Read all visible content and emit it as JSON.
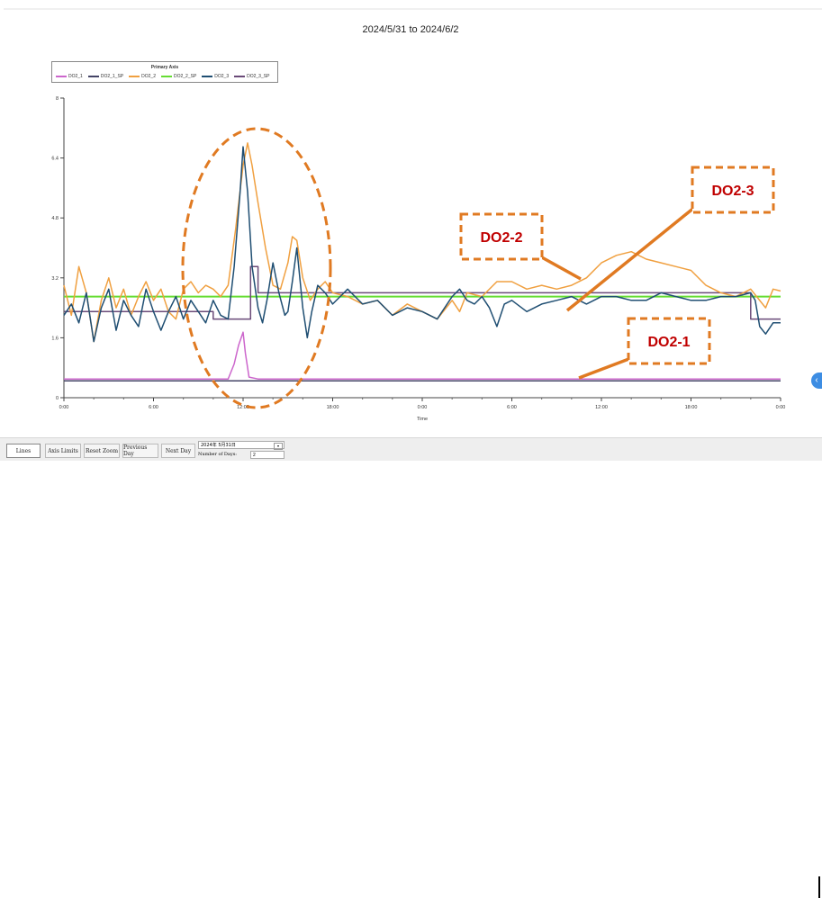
{
  "chart_data": {
    "type": "line",
    "title": "2024/5/31 to 2024/6/2",
    "xlabel": "Time",
    "ylabel": "",
    "xlim": [
      0,
      48
    ],
    "ylim": [
      0,
      8
    ],
    "grid": false,
    "y_ticks": [
      "0",
      "1.6",
      "3.2",
      "4.8",
      "6.4",
      "8"
    ],
    "y_tick_values": [
      0,
      1.6,
      3.2,
      4.8,
      6.4,
      8
    ],
    "x_ticks": [
      "0:00",
      "6:00",
      "12:00",
      "18:00",
      "0:00",
      "6:00",
      "12:00",
      "18:00",
      "0:00"
    ],
    "x_tick_values": [
      0,
      6,
      12,
      18,
      24,
      30,
      36,
      42,
      48
    ],
    "legend": {
      "title": "Primary Axis",
      "placement": "top-left",
      "entries": [
        "DO2_1",
        "DO2_1_SP",
        "DO2_2",
        "DO2_2_SP",
        "DO2_3",
        "DO2_3_SP"
      ]
    },
    "series": [
      {
        "name": "DO2_1",
        "color": "#cc66cc",
        "x": [
          0,
          8,
          10.5,
          11,
          11.4,
          11.7,
          12,
          12.15,
          12.4,
          13,
          20,
          30,
          40,
          48
        ],
        "y": [
          0.5,
          0.5,
          0.5,
          0.5,
          0.9,
          1.4,
          1.75,
          1.2,
          0.55,
          0.5,
          0.5,
          0.5,
          0.5,
          0.5
        ]
      },
      {
        "name": "DO2_1_SP",
        "color": "#444466",
        "x": [
          0,
          48
        ],
        "y": [
          0.45,
          0.45
        ]
      },
      {
        "name": "DO2_2",
        "color": "#f0a040",
        "x": [
          0,
          0.5,
          1,
          1.5,
          2,
          2.5,
          3,
          3.5,
          4,
          4.5,
          5,
          5.5,
          6,
          6.5,
          7,
          7.5,
          8,
          8.5,
          9,
          9.5,
          10,
          10.5,
          11,
          11.5,
          12,
          12.3,
          12.6,
          13,
          13.5,
          14,
          14.5,
          15,
          15.3,
          15.6,
          16,
          16.5,
          17,
          17.5,
          18,
          19,
          20,
          21,
          22,
          23,
          24,
          25,
          26,
          26.5,
          27,
          28,
          29,
          30,
          31,
          32,
          33,
          34,
          35,
          36,
          37,
          38,
          39,
          40,
          41,
          42,
          43,
          44,
          45,
          46,
          47,
          47.5,
          48
        ],
        "y": [
          3.0,
          2.2,
          3.5,
          2.8,
          1.5,
          2.6,
          3.2,
          2.4,
          2.9,
          2.2,
          2.7,
          3.1,
          2.6,
          2.9,
          2.3,
          2.1,
          2.9,
          3.1,
          2.8,
          3.0,
          2.9,
          2.7,
          3.0,
          4.5,
          6.2,
          6.8,
          6.2,
          5.2,
          4.0,
          3.0,
          2.9,
          3.6,
          4.3,
          4.2,
          3.2,
          2.6,
          2.9,
          3.1,
          2.8,
          2.7,
          2.5,
          2.6,
          2.2,
          2.5,
          2.3,
          2.1,
          2.6,
          2.3,
          2.8,
          2.7,
          3.1,
          3.1,
          2.9,
          3.0,
          2.9,
          3.0,
          3.2,
          3.6,
          3.8,
          3.9,
          3.7,
          3.6,
          3.5,
          3.4,
          3.0,
          2.8,
          2.7,
          2.9,
          2.4,
          2.9,
          2.85
        ]
      },
      {
        "name": "DO2_2_SP",
        "color": "#66dd33",
        "x": [
          0,
          48
        ],
        "y": [
          2.7,
          2.7
        ]
      },
      {
        "name": "DO2_3",
        "color": "#1f4e72",
        "x": [
          0,
          0.5,
          1,
          1.5,
          2,
          2.5,
          3,
          3.5,
          4,
          4.5,
          5,
          5.5,
          6,
          6.5,
          7,
          7.5,
          8,
          8.5,
          9,
          9.5,
          10,
          10.5,
          11,
          11.4,
          11.8,
          12,
          12.3,
          12.6,
          13,
          13.3,
          13.6,
          14,
          14.4,
          14.8,
          15,
          15.3,
          15.6,
          16,
          16.3,
          16.6,
          17,
          17.5,
          18,
          19,
          20,
          21,
          22,
          23,
          24,
          25,
          26,
          26.5,
          27,
          27.5,
          28,
          28.5,
          29,
          29.5,
          30,
          31,
          32,
          33,
          34,
          35,
          36,
          37,
          38,
          39,
          40,
          41,
          42,
          43,
          44,
          45,
          46,
          46.3,
          46.6,
          47,
          47.5,
          48
        ],
        "y": [
          2.2,
          2.5,
          2.0,
          2.8,
          1.5,
          2.4,
          2.9,
          1.8,
          2.6,
          2.2,
          1.9,
          2.9,
          2.3,
          1.8,
          2.3,
          2.7,
          2.1,
          2.6,
          2.3,
          2.0,
          2.6,
          2.2,
          2.1,
          3.5,
          5.5,
          6.7,
          5.5,
          3.5,
          2.4,
          2.0,
          2.6,
          3.6,
          2.8,
          2.2,
          2.3,
          3.1,
          4.0,
          2.4,
          1.6,
          2.3,
          3.0,
          2.8,
          2.5,
          2.9,
          2.5,
          2.6,
          2.2,
          2.4,
          2.3,
          2.1,
          2.7,
          2.9,
          2.6,
          2.5,
          2.7,
          2.4,
          1.9,
          2.5,
          2.6,
          2.3,
          2.5,
          2.6,
          2.7,
          2.5,
          2.7,
          2.7,
          2.6,
          2.6,
          2.8,
          2.7,
          2.6,
          2.6,
          2.7,
          2.7,
          2.8,
          2.6,
          1.9,
          1.7,
          2.0,
          2.0
        ]
      },
      {
        "name": "DO2_3_SP",
        "color": "#6a4a78",
        "x": [
          0,
          10,
          10,
          12.5,
          12.5,
          13,
          13,
          13.5,
          13.5,
          46,
          46,
          48
        ],
        "y": [
          2.3,
          2.3,
          2.1,
          2.1,
          3.5,
          3.5,
          2.8,
          2.8,
          2.8,
          2.8,
          2.1,
          2.1
        ]
      }
    ],
    "annotations": [
      {
        "label": "DO2-3"
      },
      {
        "label": "DO2-2"
      },
      {
        "label": "DO2-1"
      }
    ]
  },
  "toolbar": {
    "lines_label": "Lines",
    "axis_limits_label": "Axis Limits",
    "reset_zoom_label": "Reset Zoom",
    "previous_day_label": "Previous Day",
    "next_day_label": "Next Day",
    "date_value": "2024年 5月31日",
    "days_label": "Number of Days:",
    "days_value": "2"
  }
}
